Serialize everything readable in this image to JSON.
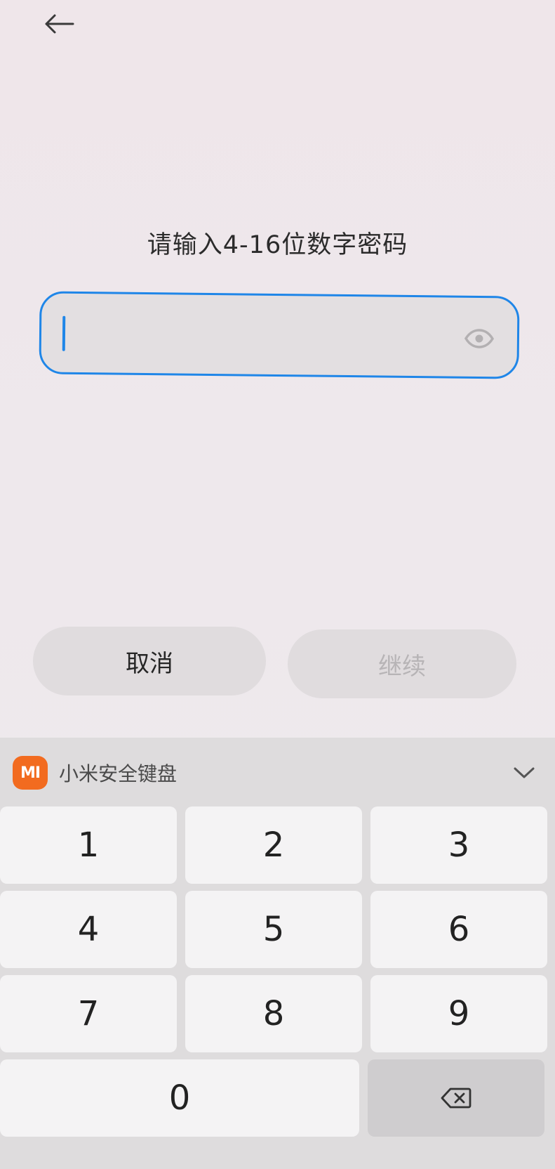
{
  "header": {
    "back_icon": "arrow-left-icon"
  },
  "prompt": "请输入4-16位数字密码",
  "password_field": {
    "value": "",
    "eye_icon": "eye-icon"
  },
  "buttons": {
    "cancel": "取消",
    "continue": "继续"
  },
  "keyboard": {
    "brand": "MI",
    "title": "小米安全键盘",
    "collapse_icon": "chevron-down-icon",
    "keys": [
      "1",
      "2",
      "3",
      "4",
      "5",
      "6",
      "7",
      "8",
      "9",
      "0"
    ],
    "delete_icon": "backspace-icon"
  },
  "colors": {
    "accent": "#1f86e8",
    "brand": "#f26b1f"
  }
}
